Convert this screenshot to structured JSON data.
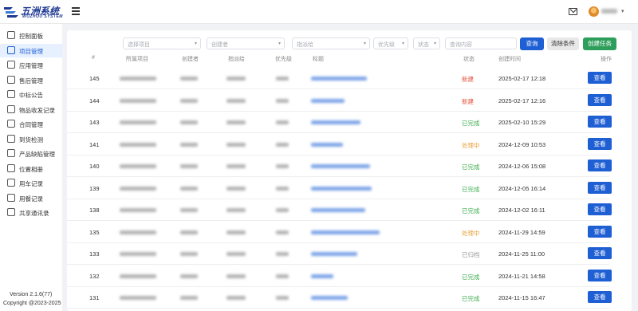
{
  "brand": {
    "title": "五洲系统",
    "subtitle": "WUZHOU SYSTEM"
  },
  "header": {
    "mail_icon": "mail-icon",
    "avatar_icon": "avatar"
  },
  "sidebar": {
    "items": [
      {
        "label": "控制面板",
        "icon": "dashboard-icon",
        "active": false
      },
      {
        "label": "项目管理",
        "icon": "project-icon",
        "active": true
      },
      {
        "label": "应用管理",
        "icon": "app-icon",
        "active": false
      },
      {
        "label": "售后管理",
        "icon": "aftersale-icon",
        "active": false
      },
      {
        "label": "中标公告",
        "icon": "announcement-icon",
        "active": false
      },
      {
        "label": "物品收发记录",
        "icon": "package-icon",
        "active": false
      },
      {
        "label": "合同管理",
        "icon": "contract-icon",
        "active": false
      },
      {
        "label": "到货检测",
        "icon": "inspection-icon",
        "active": false
      },
      {
        "label": "产品缺陷管理",
        "icon": "defect-icon",
        "active": false
      },
      {
        "label": "位置相册",
        "icon": "album-icon",
        "active": false
      },
      {
        "label": "用车记录",
        "icon": "car-icon",
        "active": false
      },
      {
        "label": "用餐记录",
        "icon": "meal-icon",
        "active": false
      },
      {
        "label": "共享通讯录",
        "icon": "contacts-icon",
        "active": false
      }
    ],
    "version": "Version 2.1.6(77)",
    "copyright": "Copyright @2023-2025"
  },
  "filters": {
    "project_placeholder": "选择项目",
    "creator_placeholder": "创建者",
    "assignee_placeholder": "指派给",
    "priority_placeholder": "优先级",
    "status_placeholder": "状态",
    "search_placeholder": "查询内容"
  },
  "buttons": {
    "query": "查询",
    "clear": "清除条件",
    "create": "创建任务",
    "view": "查看"
  },
  "table": {
    "headers": [
      "#",
      "所属项目",
      "创建者",
      "指派给",
      "优先级",
      "标题",
      "状态",
      "创建时间",
      "操作"
    ],
    "rows": [
      {
        "id": "145",
        "status": "新建",
        "time": "2025-02-17 12:18"
      },
      {
        "id": "144",
        "status": "新建",
        "time": "2025-02-17 12:16"
      },
      {
        "id": "143",
        "status": "已完成",
        "time": "2025-02-10 15:29"
      },
      {
        "id": "141",
        "status": "处理中",
        "time": "2024-12-09 10:53"
      },
      {
        "id": "140",
        "status": "已完成",
        "time": "2024-12-06 15:08"
      },
      {
        "id": "139",
        "status": "已完成",
        "time": "2024-12-05 16:14"
      },
      {
        "id": "138",
        "status": "已完成",
        "time": "2024-12-02 16:11"
      },
      {
        "id": "135",
        "status": "处理中",
        "time": "2024-11-29 14:59"
      },
      {
        "id": "133",
        "status": "已归档",
        "time": "2024-11-25 11:00"
      },
      {
        "id": "132",
        "status": "已完成",
        "time": "2024-11-21 14:58"
      },
      {
        "id": "131",
        "status": "已完成",
        "time": "2024-11-15 16:47"
      }
    ]
  },
  "status_colors": {
    "新建": "#e5533c",
    "已完成": "#3fae4f",
    "处理中": "#e8a13c",
    "已归档": "#999999"
  },
  "colors": {
    "primary": "#1f5fd4",
    "success": "#2e9e5b"
  }
}
